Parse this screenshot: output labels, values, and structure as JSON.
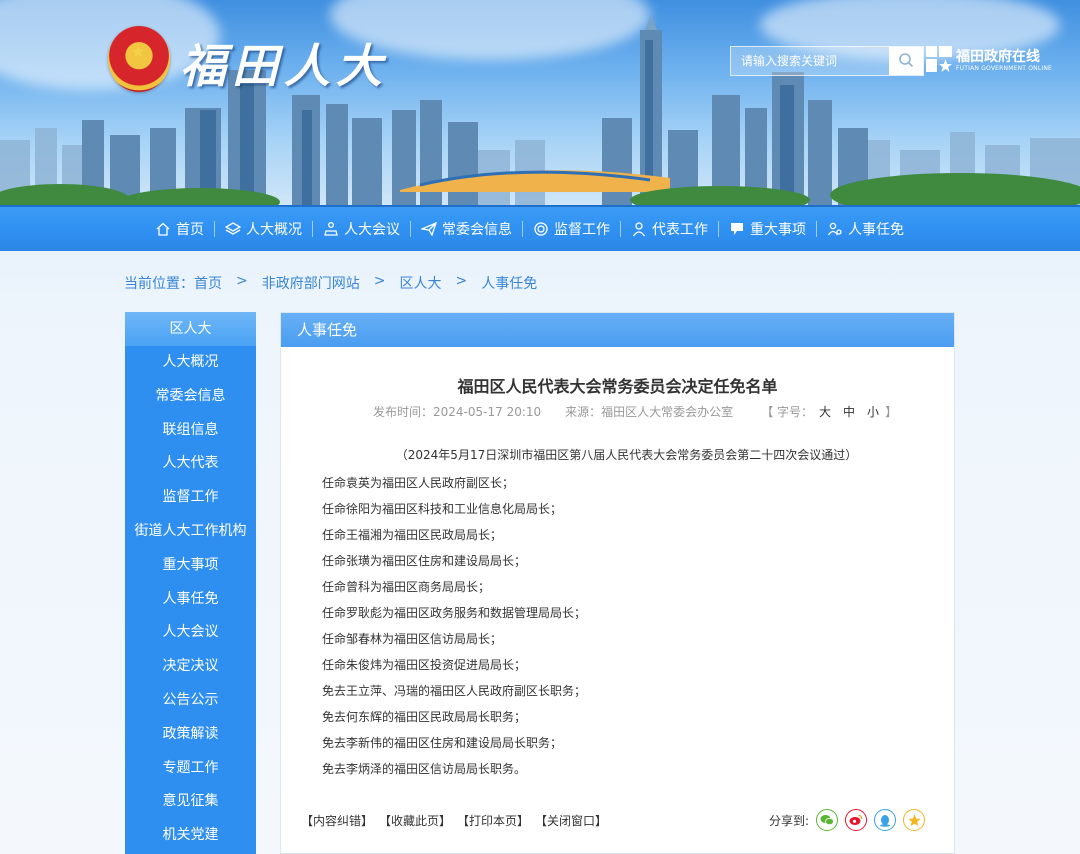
{
  "header": {
    "site_title": "福田人大",
    "search_placeholder": "请输入搜索关键词",
    "gov_name": "福田政府在线",
    "gov_sub": "FUTIAN GOVERNMENT ONLINE"
  },
  "nav": {
    "items": [
      {
        "label": "首页",
        "icon": "home-icon"
      },
      {
        "label": "人大概况",
        "icon": "layers-icon"
      },
      {
        "label": "人大会议",
        "icon": "meeting-icon"
      },
      {
        "label": "常委会信息",
        "icon": "send-icon"
      },
      {
        "label": "监督工作",
        "icon": "target-icon"
      },
      {
        "label": "代表工作",
        "icon": "person-icon"
      },
      {
        "label": "重大事项",
        "icon": "flag-icon"
      },
      {
        "label": "人事任免",
        "icon": "people-icon"
      }
    ]
  },
  "breadcrumb": {
    "prefix": "当前位置：",
    "items": [
      "首页",
      "非政府部门网站",
      "区人大",
      "人事任免"
    ],
    "separator": ">"
  },
  "sidebar": {
    "title": "区人大",
    "items": [
      "人大概况",
      "常委会信息",
      "联组信息",
      "人大代表",
      "监督工作",
      "街道人大工作机构",
      "重大事项",
      "人事任免",
      "人大会议",
      "决定决议",
      "公告公示",
      "政策解读",
      "专题工作",
      "意见征集",
      "机关党建"
    ]
  },
  "article": {
    "section": "人事任免",
    "title": "福田区人民代表大会常务委员会决定任免名单",
    "publish_label": "发布时间：",
    "publish_time": "2024-05-17 20:10",
    "source_label": "来源：",
    "source": "福田区人大常委会办公室",
    "font_size_label": "【 字号：",
    "font_sizes": [
      "大",
      "中",
      "小"
    ],
    "font_size_close": "】",
    "subtitle": "（2024年5月17日深圳市福田区第八届人民代表大会常务委员会第二十四次会议通过）",
    "lines": [
      "任命袁英为福田区人民政府副区长；",
      "任命徐阳为福田区科技和工业信息化局局长；",
      "任命王福湘为福田区民政局局长；",
      "任命张璜为福田区住房和建设局局长；",
      "任命曾科为福田区商务局局长；",
      "任命罗耿彪为福田区政务服务和数据管理局局长；",
      "任命邹春林为福田区信访局局长；",
      "任命朱俊炜为福田区投资促进局局长；",
      "免去王立萍、冯瑞的福田区人民政府副区长职务；",
      "免去何东辉的福田区民政局局长职务；",
      "免去李新伟的福田区住房和建设局局长职务；",
      "免去李炳泽的福田区信访局局长职务。"
    ],
    "actions": [
      "【内容纠错】",
      "【收藏此页】",
      "【打印本页】",
      "【关闭窗口】"
    ],
    "share_label": "分享到:",
    "share_icons": [
      {
        "name": "wechat-icon",
        "color": "#5bb531"
      },
      {
        "name": "weibo-icon",
        "color": "#e6162d"
      },
      {
        "name": "qq-icon",
        "color": "#3aa0e8"
      },
      {
        "name": "qzone-icon",
        "color": "#f4b521"
      }
    ]
  }
}
